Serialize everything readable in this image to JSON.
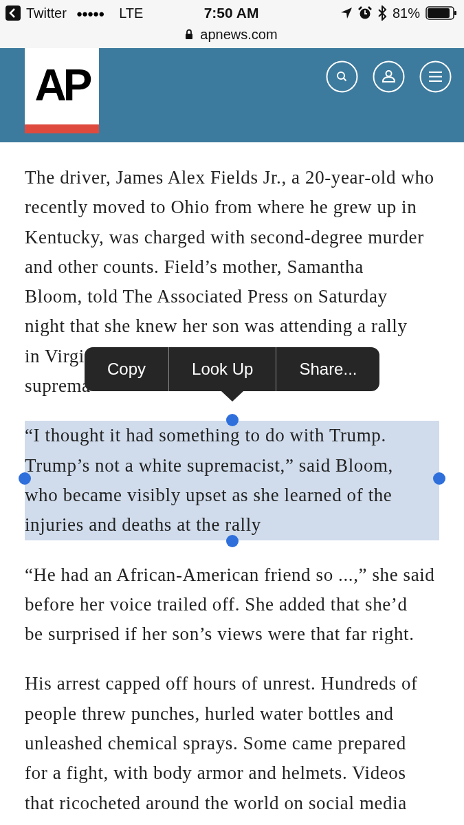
{
  "status_bar": {
    "back_app": "Twitter",
    "signal": "●●●●●",
    "network": "LTE",
    "time": "7:50 AM",
    "battery": "81%",
    "url": "apnews.com"
  },
  "header": {
    "logo": "AP"
  },
  "article": {
    "paragraphs": [
      {
        "lines": [
          "The driver, James Alex Fields Jr., a 20-year-old who",
          "recently moved to Ohio from where he grew up in",
          "Kentucky, was charged with second-degree murder",
          "and other counts. Field’s mother, Samantha",
          "Bloom, told The Associated Press on Saturday",
          "night that she knew her son was attending a rally",
          "in Virgi",
          "suprema"
        ],
        "selected": false
      },
      {
        "lines": [
          "“I thought it had something to do with Trump.",
          "Trump’s not a white supremacist,” said Bloom,",
          "who became visibly upset as she learned of the",
          "injuries and deaths at the rally"
        ],
        "selected": true
      },
      {
        "lines": [
          "“He had an African-American friend so ...,” she said",
          "before her voice trailed off. She added that she’d",
          "be surprised if her son’s views were that far right."
        ],
        "selected": false
      },
      {
        "lines": [
          "His arrest capped off hours of unrest. Hundreds of",
          "people threw punches, hurled water bottles and",
          "unleashed chemical sprays. Some came prepared",
          "for a fight, with body armor and helmets. Videos",
          "that ricocheted around the world on social media"
        ],
        "selected": false
      }
    ]
  },
  "context_menu": {
    "items": [
      "Copy",
      "Look Up",
      "Share..."
    ]
  }
}
